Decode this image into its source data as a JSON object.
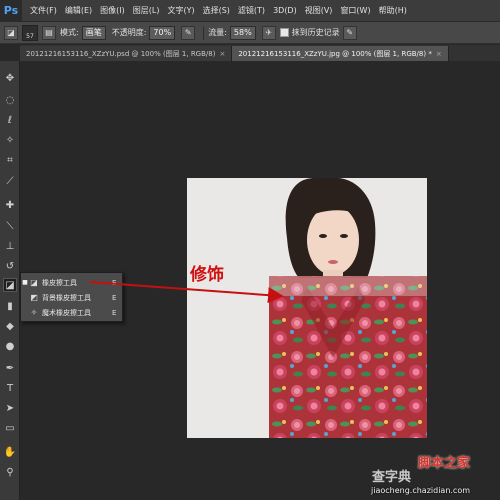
{
  "app": {
    "logo": "Ps"
  },
  "menu": [
    "文件(F)",
    "编辑(E)",
    "图像(I)",
    "图层(L)",
    "文字(Y)",
    "选择(S)",
    "滤镜(T)",
    "3D(D)",
    "视图(V)",
    "窗口(W)",
    "帮助(H)"
  ],
  "options": {
    "brush_size": "57",
    "mode_label": "模式:",
    "mode_value": "画笔",
    "opacity_label": "不透明度:",
    "opacity_value": "70%",
    "flow_label": "流量:",
    "flow_value": "58%",
    "history_label": "抹到历史记录"
  },
  "tabs": [
    {
      "label": "20121216153116_XZzYU.psd @ 100% (图层 1, RGB/8)",
      "close": "×"
    },
    {
      "label": "20121216153116_XZzYU.jpg @ 100% (图层 1, RGB/8) *",
      "close": "×"
    }
  ],
  "flyout": {
    "items": [
      {
        "label": "橡皮擦工具",
        "key": "E",
        "bullet": "■",
        "icon": "eraser-icon"
      },
      {
        "label": "背景橡皮擦工具",
        "key": "E",
        "bullet": "",
        "icon": "background-eraser-icon"
      },
      {
        "label": "魔术橡皮擦工具",
        "key": "E",
        "bullet": "",
        "icon": "magic-eraser-icon"
      }
    ]
  },
  "annotation": {
    "label": "修饰"
  },
  "watermarks": {
    "left": "查字典",
    "right": "脚本之家",
    "url": "jiaocheng.chazidian.com"
  },
  "colors": {
    "annotation": "#d01010",
    "canvas_bg": "#282828",
    "panel_bg": "#3c3c3c"
  }
}
